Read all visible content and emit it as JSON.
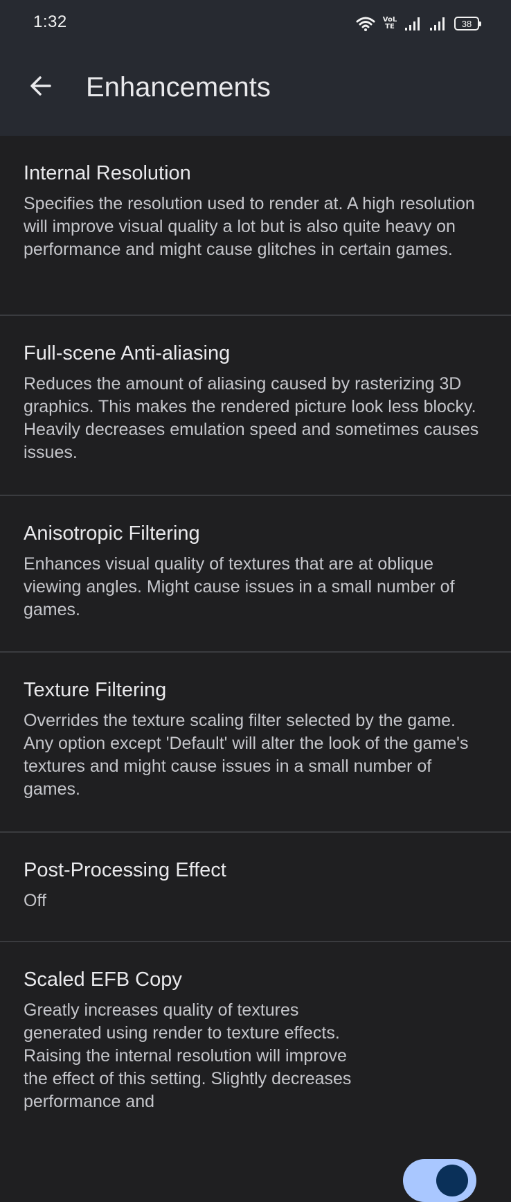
{
  "status_bar": {
    "time": "1:32",
    "volte_label": "VoLTE",
    "battery_level": "38",
    "icons": [
      "wifi-icon",
      "volte-icon",
      "signal-icon",
      "signal-icon",
      "battery-icon"
    ]
  },
  "app_bar": {
    "back_icon": "arrow-back-icon",
    "title": "Enhancements"
  },
  "settings": [
    {
      "title": "Internal Resolution",
      "description": "Specifies the resolution used to render at. A high resolution will improve visual quality a lot but is also quite heavy on performance and might cause glitches in certain games."
    },
    {
      "title": "Full-scene Anti-aliasing",
      "description": "Reduces the amount of aliasing caused by rasterizing 3D graphics. This makes the rendered picture look less blocky. Heavily decreases emulation speed and sometimes causes issues."
    },
    {
      "title": "Anisotropic Filtering",
      "description": "Enhances visual quality of textures that are at oblique viewing angles. Might cause issues in a small number of games."
    },
    {
      "title": "Texture Filtering",
      "description": "Overrides the texture scaling filter selected by the game. Any option except 'Default' will alter the look of the game's textures and might cause issues in a small number of games."
    },
    {
      "title": "Post-Processing Effect",
      "description": "Off"
    },
    {
      "title": "Scaled EFB Copy",
      "description": "Greatly increases quality of textures generated using render to texture effects. Raising the internal resolution will improve the effect of this setting. Slightly decreases performance and",
      "toggle_on": true
    }
  ],
  "colors": {
    "background": "#1f1f21",
    "app_bar": "#272a31",
    "toggle_track": "#a9c7ff",
    "toggle_thumb": "#0a3059"
  }
}
